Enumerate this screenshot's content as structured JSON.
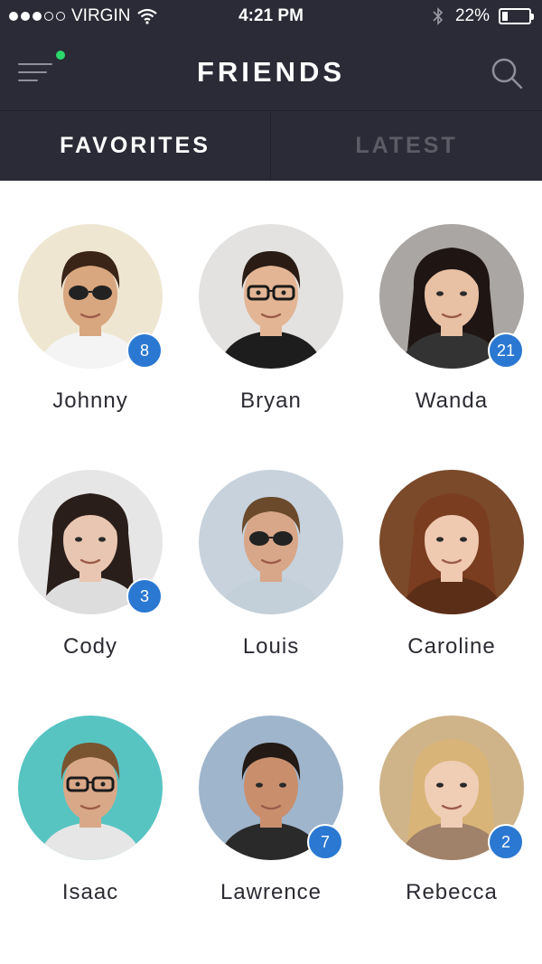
{
  "status_bar": {
    "carrier": "VIRGIN",
    "signal_bars_filled": 3,
    "signal_bars_total": 5,
    "time": "4:21 PM",
    "battery_text": "22%",
    "battery_level": 0.22
  },
  "header": {
    "title": "FRIENDS",
    "menu_icon": "hamburger-menu-icon",
    "search_icon": "search-icon"
  },
  "tabs": [
    {
      "label": "FAVORITES",
      "active": true
    },
    {
      "label": "LATEST",
      "active": false
    }
  ],
  "colors": {
    "header_bg": "#2a2b36",
    "badge": "#2a78d1",
    "notification_dot": "#2bd96b"
  },
  "friends": [
    {
      "name": "Johnny",
      "badge": "8"
    },
    {
      "name": "Bryan",
      "badge": ""
    },
    {
      "name": "Wanda",
      "badge": "21"
    },
    {
      "name": "Cody",
      "badge": "3"
    },
    {
      "name": "Louis",
      "badge": ""
    },
    {
      "name": "Caroline",
      "badge": ""
    },
    {
      "name": "Isaac",
      "badge": ""
    },
    {
      "name": "Lawrence",
      "badge": "7"
    },
    {
      "name": "Rebecca",
      "badge": "2"
    }
  ]
}
